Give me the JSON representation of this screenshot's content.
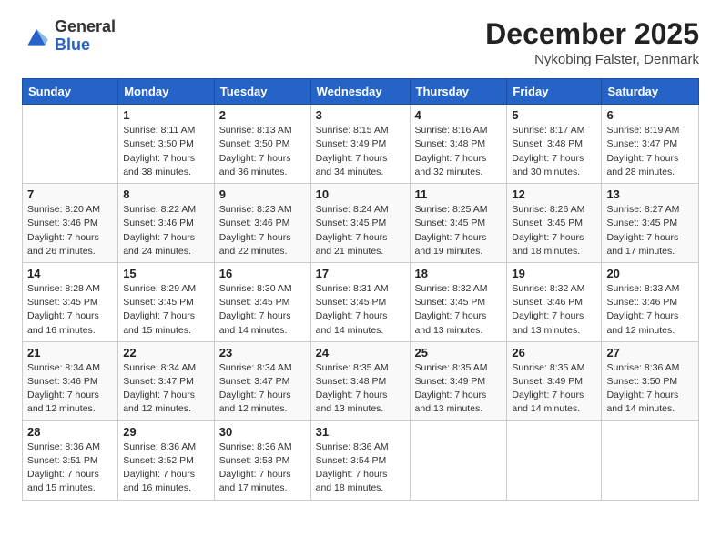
{
  "logo": {
    "general": "General",
    "blue": "Blue"
  },
  "title": "December 2025",
  "location": "Nykobing Falster, Denmark",
  "days_header": [
    "Sunday",
    "Monday",
    "Tuesday",
    "Wednesday",
    "Thursday",
    "Friday",
    "Saturday"
  ],
  "weeks": [
    [
      {
        "day": "",
        "info": ""
      },
      {
        "day": "1",
        "info": "Sunrise: 8:11 AM\nSunset: 3:50 PM\nDaylight: 7 hours\nand 38 minutes."
      },
      {
        "day": "2",
        "info": "Sunrise: 8:13 AM\nSunset: 3:50 PM\nDaylight: 7 hours\nand 36 minutes."
      },
      {
        "day": "3",
        "info": "Sunrise: 8:15 AM\nSunset: 3:49 PM\nDaylight: 7 hours\nand 34 minutes."
      },
      {
        "day": "4",
        "info": "Sunrise: 8:16 AM\nSunset: 3:48 PM\nDaylight: 7 hours\nand 32 minutes."
      },
      {
        "day": "5",
        "info": "Sunrise: 8:17 AM\nSunset: 3:48 PM\nDaylight: 7 hours\nand 30 minutes."
      },
      {
        "day": "6",
        "info": "Sunrise: 8:19 AM\nSunset: 3:47 PM\nDaylight: 7 hours\nand 28 minutes."
      }
    ],
    [
      {
        "day": "7",
        "info": "Sunrise: 8:20 AM\nSunset: 3:46 PM\nDaylight: 7 hours\nand 26 minutes."
      },
      {
        "day": "8",
        "info": "Sunrise: 8:22 AM\nSunset: 3:46 PM\nDaylight: 7 hours\nand 24 minutes."
      },
      {
        "day": "9",
        "info": "Sunrise: 8:23 AM\nSunset: 3:46 PM\nDaylight: 7 hours\nand 22 minutes."
      },
      {
        "day": "10",
        "info": "Sunrise: 8:24 AM\nSunset: 3:45 PM\nDaylight: 7 hours\nand 21 minutes."
      },
      {
        "day": "11",
        "info": "Sunrise: 8:25 AM\nSunset: 3:45 PM\nDaylight: 7 hours\nand 19 minutes."
      },
      {
        "day": "12",
        "info": "Sunrise: 8:26 AM\nSunset: 3:45 PM\nDaylight: 7 hours\nand 18 minutes."
      },
      {
        "day": "13",
        "info": "Sunrise: 8:27 AM\nSunset: 3:45 PM\nDaylight: 7 hours\nand 17 minutes."
      }
    ],
    [
      {
        "day": "14",
        "info": "Sunrise: 8:28 AM\nSunset: 3:45 PM\nDaylight: 7 hours\nand 16 minutes."
      },
      {
        "day": "15",
        "info": "Sunrise: 8:29 AM\nSunset: 3:45 PM\nDaylight: 7 hours\nand 15 minutes."
      },
      {
        "day": "16",
        "info": "Sunrise: 8:30 AM\nSunset: 3:45 PM\nDaylight: 7 hours\nand 14 minutes."
      },
      {
        "day": "17",
        "info": "Sunrise: 8:31 AM\nSunset: 3:45 PM\nDaylight: 7 hours\nand 14 minutes."
      },
      {
        "day": "18",
        "info": "Sunrise: 8:32 AM\nSunset: 3:45 PM\nDaylight: 7 hours\nand 13 minutes."
      },
      {
        "day": "19",
        "info": "Sunrise: 8:32 AM\nSunset: 3:46 PM\nDaylight: 7 hours\nand 13 minutes."
      },
      {
        "day": "20",
        "info": "Sunrise: 8:33 AM\nSunset: 3:46 PM\nDaylight: 7 hours\nand 12 minutes."
      }
    ],
    [
      {
        "day": "21",
        "info": "Sunrise: 8:34 AM\nSunset: 3:46 PM\nDaylight: 7 hours\nand 12 minutes."
      },
      {
        "day": "22",
        "info": "Sunrise: 8:34 AM\nSunset: 3:47 PM\nDaylight: 7 hours\nand 12 minutes."
      },
      {
        "day": "23",
        "info": "Sunrise: 8:34 AM\nSunset: 3:47 PM\nDaylight: 7 hours\nand 12 minutes."
      },
      {
        "day": "24",
        "info": "Sunrise: 8:35 AM\nSunset: 3:48 PM\nDaylight: 7 hours\nand 13 minutes."
      },
      {
        "day": "25",
        "info": "Sunrise: 8:35 AM\nSunset: 3:49 PM\nDaylight: 7 hours\nand 13 minutes."
      },
      {
        "day": "26",
        "info": "Sunrise: 8:35 AM\nSunset: 3:49 PM\nDaylight: 7 hours\nand 14 minutes."
      },
      {
        "day": "27",
        "info": "Sunrise: 8:36 AM\nSunset: 3:50 PM\nDaylight: 7 hours\nand 14 minutes."
      }
    ],
    [
      {
        "day": "28",
        "info": "Sunrise: 8:36 AM\nSunset: 3:51 PM\nDaylight: 7 hours\nand 15 minutes."
      },
      {
        "day": "29",
        "info": "Sunrise: 8:36 AM\nSunset: 3:52 PM\nDaylight: 7 hours\nand 16 minutes."
      },
      {
        "day": "30",
        "info": "Sunrise: 8:36 AM\nSunset: 3:53 PM\nDaylight: 7 hours\nand 17 minutes."
      },
      {
        "day": "31",
        "info": "Sunrise: 8:36 AM\nSunset: 3:54 PM\nDaylight: 7 hours\nand 18 minutes."
      },
      {
        "day": "",
        "info": ""
      },
      {
        "day": "",
        "info": ""
      },
      {
        "day": "",
        "info": ""
      }
    ]
  ]
}
